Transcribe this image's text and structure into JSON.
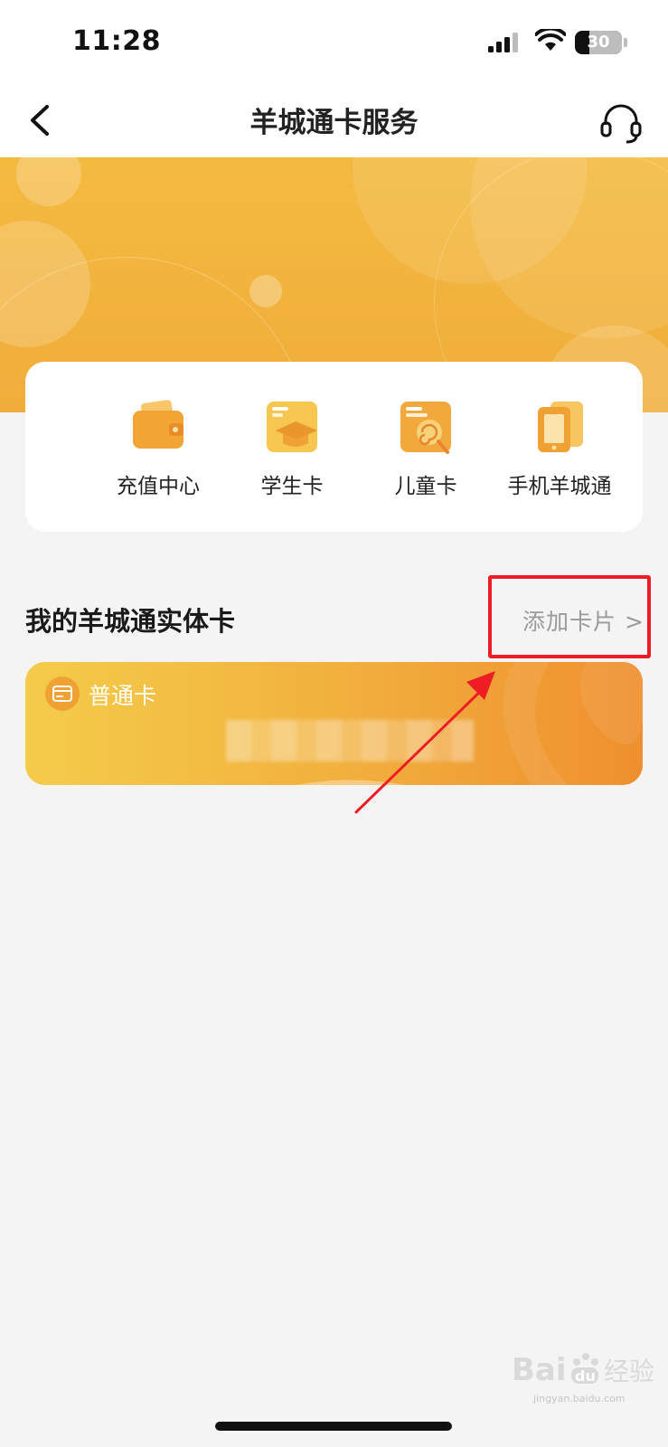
{
  "status_bar": {
    "time": "11:28",
    "battery": "30",
    "battery_fraction": 0.3
  },
  "nav": {
    "title": "羊城通卡服务",
    "back_icon": "chevron-left-icon",
    "service_icon": "headset-icon"
  },
  "quick_actions": [
    {
      "label": "充值中心",
      "icon": "wallet-icon"
    },
    {
      "label": "学生卡",
      "icon": "graduation-cap-icon"
    },
    {
      "label": "儿童卡",
      "icon": "lollipop-icon"
    },
    {
      "label": "手机羊城通",
      "icon": "phone-card-icon"
    }
  ],
  "section": {
    "title": "我的羊城通实体卡",
    "add_label": "添加卡片 >"
  },
  "card": {
    "name": "普通卡",
    "icon": "card-icon",
    "number_masked": true
  },
  "annotation": {
    "highlight_color": "#ee1c24"
  },
  "watermark": {
    "brand": "Baidu经验",
    "url": "jingyan.baidu.com"
  },
  "colors": {
    "banner": "#f2b13e",
    "card_start": "#f4cb4a",
    "card_end": "#ef8f2f",
    "accent": "#f0a133"
  }
}
